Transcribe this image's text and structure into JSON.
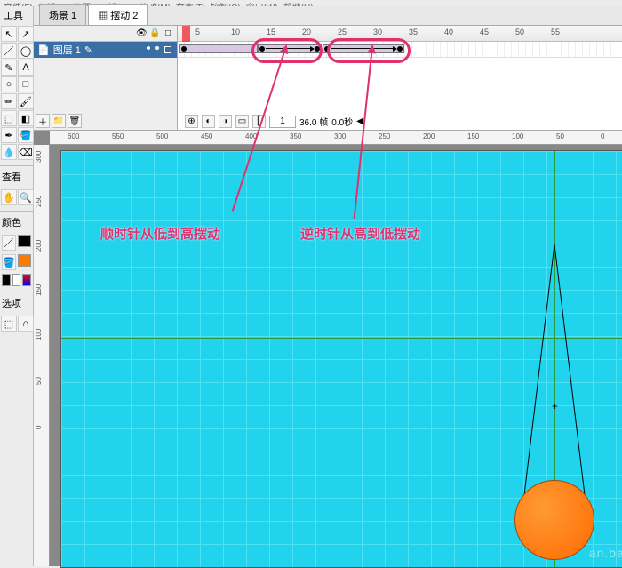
{
  "menu": {
    "items": [
      "文件(F)",
      "编辑(E)",
      "视图(V)",
      "插入(I)",
      "修改(M)",
      "文本(T)",
      "控制(C)",
      "窗口(W)",
      "帮助(H)"
    ]
  },
  "panels": {
    "tools_label": "工具",
    "view_label": "查看",
    "color_label": "颜色",
    "options_label": "选项"
  },
  "swatches": {
    "stroke": "#000000",
    "fill": "#ff7a00"
  },
  "tabs": {
    "scene": "场景 1",
    "symbol": "摆动 2"
  },
  "layer": {
    "name": "图层 1"
  },
  "ruler_ticks": [
    5,
    10,
    15,
    20,
    25,
    30,
    35,
    40,
    45,
    50,
    55
  ],
  "timeline_status": {
    "frame": "1",
    "fps": "36.0 帧",
    "time": "0.0秒"
  },
  "annotations": {
    "cw": "顺时针从低到高摆动",
    "ccw": "逆时针从高到低摆动"
  },
  "hruler_ticks": [
    "600",
    "550",
    "500",
    "450",
    "400",
    "350",
    "300",
    "250",
    "200",
    "150",
    "100",
    "50",
    "0"
  ],
  "vruler_ticks": [
    "300",
    "250",
    "200",
    "150",
    "100",
    "50",
    "0"
  ],
  "chart_data": null,
  "watermark": "an.bai"
}
